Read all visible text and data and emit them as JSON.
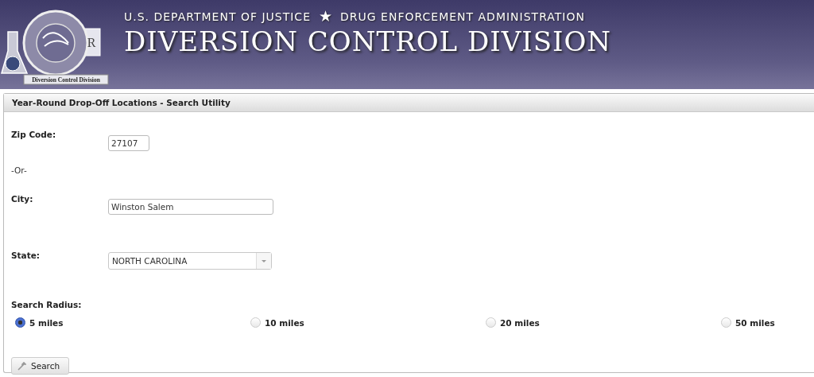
{
  "header": {
    "seal": {
      "mark": "R",
      "banner": "Diversion Control Division"
    },
    "department": "U.S. DEPARTMENT OF JUSTICE",
    "separator": "★",
    "agency": "DRUG ENFORCEMENT ADMINISTRATION",
    "division": "DIVERSION CONTROL DIVISION"
  },
  "panel": {
    "title": "Year-Round Drop-Off Locations - Search Utility"
  },
  "zip": {
    "label": "Zip Code:",
    "value": "27107"
  },
  "or_text": "-Or-",
  "city": {
    "label": "City:",
    "value": "Winston Salem"
  },
  "state": {
    "label": "State:",
    "value": "NORTH CAROLINA"
  },
  "radius": {
    "label": "Search Radius:",
    "options": [
      {
        "label": "5 miles",
        "selected": true
      },
      {
        "label": "10 miles",
        "selected": false
      },
      {
        "label": "20 miles",
        "selected": false
      },
      {
        "label": "50 miles",
        "selected": false
      }
    ]
  },
  "search_button": {
    "label": "Search"
  }
}
